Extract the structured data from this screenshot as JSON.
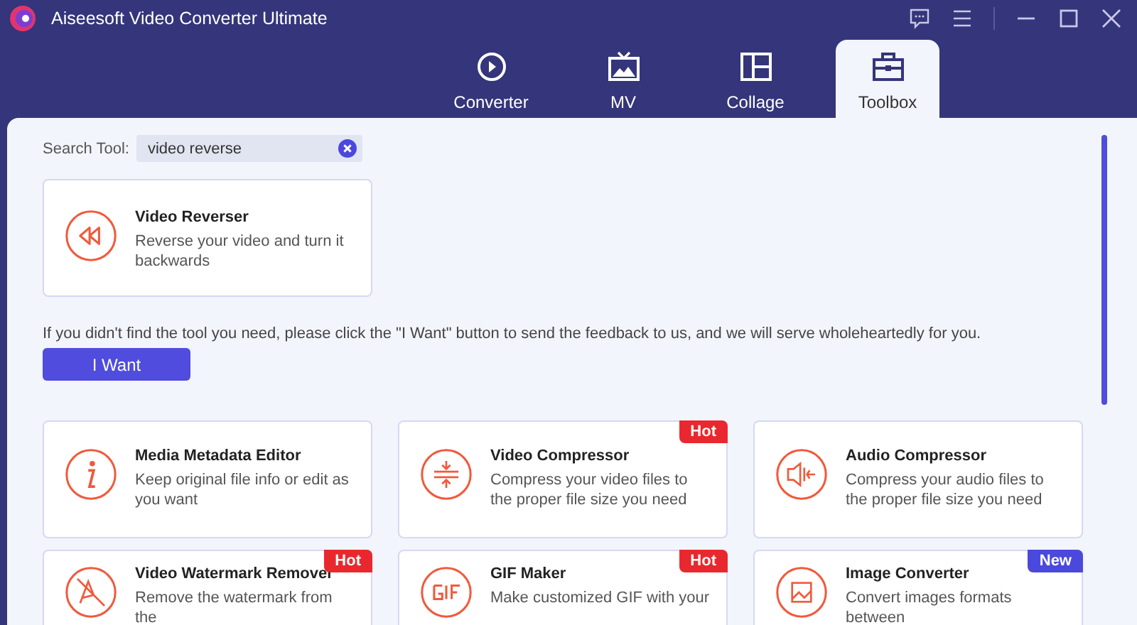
{
  "window": {
    "title": "Aiseesoft Video Converter Ultimate"
  },
  "tabs": [
    {
      "kind": "converter",
      "label": "Converter",
      "selected": false
    },
    {
      "kind": "mv",
      "label": "MV",
      "selected": false
    },
    {
      "kind": "collage",
      "label": "Collage",
      "selected": false
    },
    {
      "kind": "toolbox",
      "label": "Toolbox",
      "selected": true
    }
  ],
  "search": {
    "label": "Search Tool:",
    "value": "video reverse"
  },
  "result": {
    "kind": "reverse",
    "title": "Video Reverser",
    "description": "Reverse your video and turn it backwards"
  },
  "feedback": {
    "message": "If you didn't find the tool you need, please click the \"I Want\" button to send the feedback to us, and we will serve wholeheartedly for you.",
    "button": "I Want"
  },
  "tools": [
    {
      "kind": "info",
      "title": "Media Metadata Editor",
      "description": "Keep original file info or edit as you want"
    },
    {
      "kind": "compress",
      "title": "Video Compressor",
      "description": "Compress your video files to the proper file size you need",
      "badge": {
        "label": "Hot",
        "color": "#e8282e"
      }
    },
    {
      "kind": "audio",
      "title": "Audio Compressor",
      "description": "Compress your audio files to the proper file size you need"
    },
    {
      "kind": "watermark",
      "title": "Video Watermark Remover",
      "description": "Remove the watermark from the",
      "badge": {
        "label": "Hot",
        "color": "#e8282e"
      }
    },
    {
      "kind": "gif",
      "title": "GIF Maker",
      "description": "Make customized GIF with your",
      "badge": {
        "label": "Hot",
        "color": "#e8282e"
      }
    },
    {
      "kind": "image",
      "title": "Image Converter",
      "description": "Convert images formats between",
      "badge": {
        "label": "New",
        "color": "#4b48de"
      }
    }
  ]
}
